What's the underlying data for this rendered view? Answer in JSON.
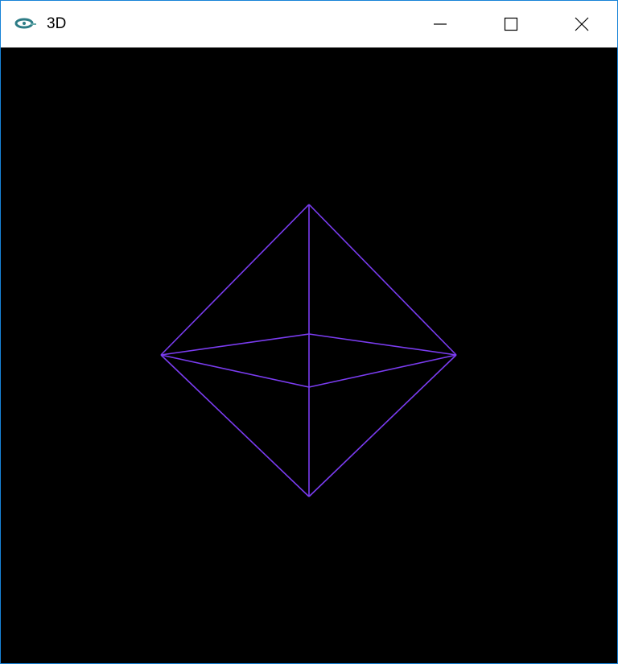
{
  "window": {
    "title": "3D",
    "icon": "app-eye-icon"
  },
  "controls": {
    "minimize": "minimize-icon",
    "maximize": "maximize-icon",
    "close": "close-icon"
  },
  "scene": {
    "shape": "octahedron wireframe",
    "line_color": "#7a3cf0",
    "background": "#000000"
  }
}
